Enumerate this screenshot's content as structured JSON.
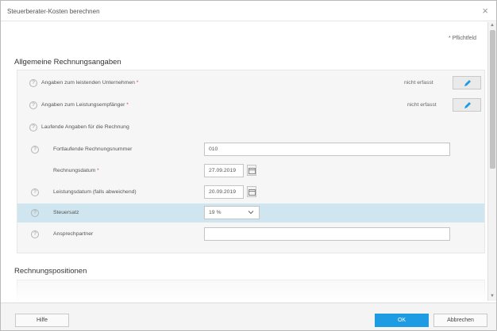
{
  "dialog": {
    "title": "Steuerberater-Kosten berechnen",
    "close_glyph": "×",
    "required_note": "* Pflichtfeld"
  },
  "general": {
    "section_title": "Allgemeine Rechnungsangaben",
    "company": {
      "label": "Angaben zum leistenden Unternehmen",
      "required_mark": " *",
      "status": "nicht erfasst"
    },
    "recipient": {
      "label": "Angaben zum Leistungsempfänger",
      "required_mark": " *",
      "status": "nicht erfasst"
    },
    "running": {
      "label": "Laufende Angaben für die Rechnung"
    },
    "invoice_number": {
      "label": "Fortlaufende Rechnungsnummer",
      "value": "010"
    },
    "invoice_date": {
      "label": "Rechnungsdatum",
      "required_mark": " *",
      "value": "27.09.2019"
    },
    "service_date": {
      "label": "Leistungsdatum (falls abweichend)",
      "value": "20.09.2019"
    },
    "tax_rate": {
      "label": "Steuersatz",
      "value": "19 %"
    },
    "contact": {
      "label": "Ansprechpartner",
      "value": ""
    }
  },
  "positions": {
    "section_title": "Rechnungspositionen"
  },
  "footer": {
    "help_label": "Hilfe",
    "ok_label": "OK",
    "cancel_label": "Abbrechen"
  },
  "icons": {
    "help": "question-circle-icon",
    "edit": "pencil-icon",
    "calendar": "calendar-icon",
    "dropdown": "chevron-down-icon",
    "close": "close-icon"
  },
  "colors": {
    "accent": "#1e9ce3",
    "highlight_row": "#cfe6f0",
    "required": "#d0457a"
  }
}
